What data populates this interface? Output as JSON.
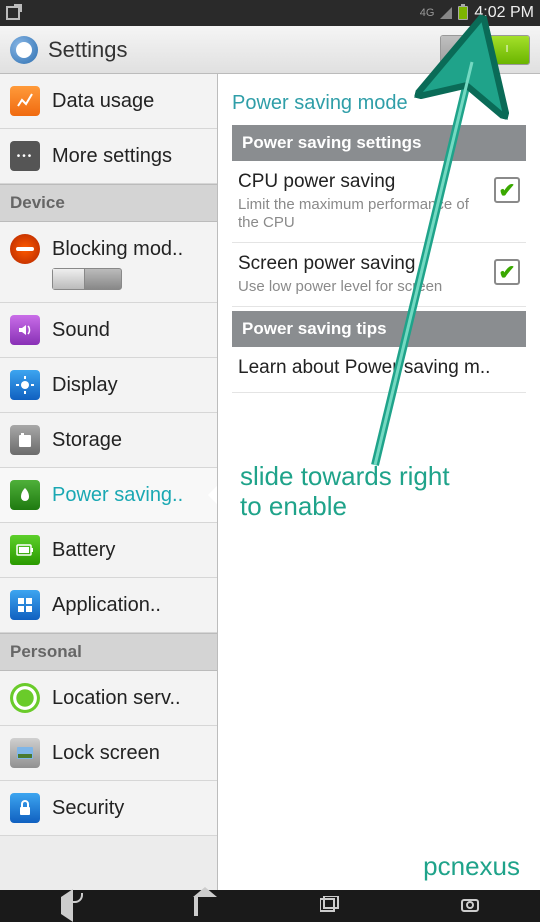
{
  "status": {
    "time": "4:02 PM",
    "signal_text": "4G"
  },
  "header": {
    "title": "Settings",
    "toggle_on_label": "I"
  },
  "sidebar": {
    "items": {
      "data_usage": "Data usage",
      "more": "More settings",
      "blocking": "Blocking mod..",
      "sound": "Sound",
      "display": "Display",
      "storage": "Storage",
      "power": "Power saving..",
      "battery": "Battery",
      "apps": "Application..",
      "location": "Location serv..",
      "lock": "Lock screen",
      "security": "Security"
    },
    "headers": {
      "device": "Device",
      "personal": "Personal"
    }
  },
  "content": {
    "mode_title": "Power saving mode",
    "settings_header": "Power saving settings",
    "cpu": {
      "title": "CPU power saving",
      "sub": "Limit the maximum performance of the CPU"
    },
    "screen": {
      "title": "Screen power saving",
      "sub": "Use low power level for screen"
    },
    "tips_header": "Power saving tips",
    "learn": "Learn about Power saving m.."
  },
  "annotation": {
    "hint": "slide towards right\nto enable",
    "watermark": "pcnexus"
  }
}
